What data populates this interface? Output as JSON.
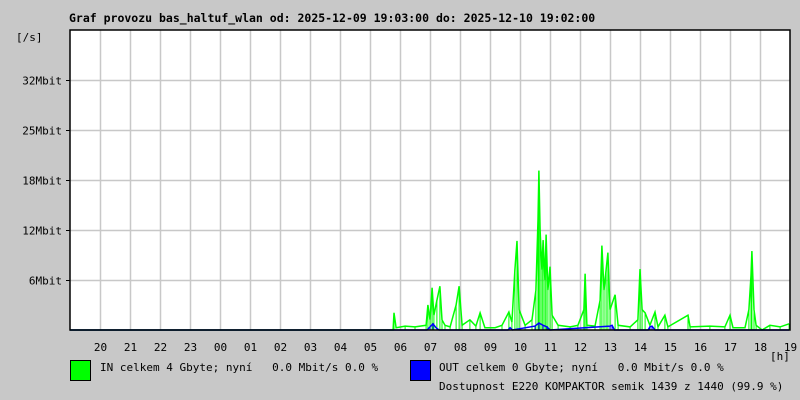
{
  "chart_data": {
    "type": "line",
    "title": "Graf provozu bas_haltuf_wlan od: 2025-12-09 19:03:00 do: 2025-12-10 19:02:00",
    "ylabel": "[/s]",
    "xlabel": "[h]",
    "x_unit": "hours since 2025-12-09 19:00",
    "xlim": [
      0,
      24
    ],
    "ylim": [
      0,
      38.4
    ],
    "y_unit": "Mbit/s",
    "grid": true,
    "yticks": [
      {
        "value": 6.4,
        "label": "6Mbit"
      },
      {
        "value": 12.8,
        "label": "12Mbit"
      },
      {
        "value": 19.2,
        "label": "18Mbit"
      },
      {
        "value": 25.6,
        "label": "25Mbit"
      },
      {
        "value": 32,
        "label": "32Mbit"
      }
    ],
    "xticks": [
      {
        "value": 1,
        "label": "20"
      },
      {
        "value": 2,
        "label": "21"
      },
      {
        "value": 3,
        "label": "22"
      },
      {
        "value": 4,
        "label": "23"
      },
      {
        "value": 5,
        "label": "00"
      },
      {
        "value": 6,
        "label": "01"
      },
      {
        "value": 7,
        "label": "02"
      },
      {
        "value": 8,
        "label": "03"
      },
      {
        "value": 9,
        "label": "04"
      },
      {
        "value": 10,
        "label": "05"
      },
      {
        "value": 11,
        "label": "06"
      },
      {
        "value": 12,
        "label": "07"
      },
      {
        "value": 13,
        "label": "08"
      },
      {
        "value": 14,
        "label": "09"
      },
      {
        "value": 15,
        "label": "10"
      },
      {
        "value": 16,
        "label": "11"
      },
      {
        "value": 17,
        "label": "12"
      },
      {
        "value": 18,
        "label": "13"
      },
      {
        "value": 19,
        "label": "14"
      },
      {
        "value": 20,
        "label": "15"
      },
      {
        "value": 21,
        "label": "16"
      },
      {
        "value": 22,
        "label": "17"
      },
      {
        "value": 23,
        "label": "18"
      },
      {
        "value": 24,
        "label": "19"
      }
    ],
    "series": [
      {
        "name": "IN",
        "color": "#00ff00",
        "points": [
          [
            10.77,
            0
          ],
          [
            10.8,
            2.2
          ],
          [
            10.87,
            0.3
          ],
          [
            11.17,
            0.5
          ],
          [
            11.5,
            0.4
          ],
          [
            11.87,
            0.6
          ],
          [
            11.93,
            3.2
          ],
          [
            12.0,
            1.3
          ],
          [
            12.07,
            5.4
          ],
          [
            12.13,
            1.9
          ],
          [
            12.23,
            3.8
          ],
          [
            12.33,
            5.6
          ],
          [
            12.4,
            1.3
          ],
          [
            12.5,
            0.6
          ],
          [
            12.67,
            0.4
          ],
          [
            12.87,
            3.2
          ],
          [
            12.97,
            5.6
          ],
          [
            13.07,
            0.6
          ],
          [
            13.33,
            1.3
          ],
          [
            13.53,
            0.5
          ],
          [
            13.67,
            2.2
          ],
          [
            13.83,
            0.3
          ],
          [
            14.17,
            0.3
          ],
          [
            14.4,
            0.6
          ],
          [
            14.63,
            2.3
          ],
          [
            14.73,
            1.0
          ],
          [
            14.83,
            7.7
          ],
          [
            14.9,
            11.4
          ],
          [
            14.97,
            2.6
          ],
          [
            15.17,
            0.6
          ],
          [
            15.4,
            1.3
          ],
          [
            15.53,
            5.1
          ],
          [
            15.6,
            14.1
          ],
          [
            15.63,
            20.4
          ],
          [
            15.67,
            12.8
          ],
          [
            15.73,
            7.7
          ],
          [
            15.77,
            11.5
          ],
          [
            15.83,
            6.4
          ],
          [
            15.87,
            12.2
          ],
          [
            15.93,
            5.1
          ],
          [
            16.0,
            8.1
          ],
          [
            16.07,
            1.9
          ],
          [
            16.27,
            0.6
          ],
          [
            16.67,
            0.4
          ],
          [
            16.93,
            0.6
          ],
          [
            17.13,
            2.6
          ],
          [
            17.17,
            7.2
          ],
          [
            17.23,
            0.6
          ],
          [
            17.5,
            0.5
          ],
          [
            17.67,
            3.8
          ],
          [
            17.73,
            10.8
          ],
          [
            17.8,
            5.1
          ],
          [
            17.87,
            7.7
          ],
          [
            17.93,
            9.9
          ],
          [
            18.0,
            2.6
          ],
          [
            18.17,
            4.5
          ],
          [
            18.27,
            0.6
          ],
          [
            18.67,
            0.4
          ],
          [
            18.93,
            1.3
          ],
          [
            19.0,
            7.8
          ],
          [
            19.07,
            2.6
          ],
          [
            19.17,
            2.2
          ],
          [
            19.33,
            0.6
          ],
          [
            19.5,
            2.3
          ],
          [
            19.6,
            0.4
          ],
          [
            19.83,
            1.9
          ],
          [
            19.93,
            0.4
          ],
          [
            20.6,
            1.9
          ],
          [
            20.67,
            0.4
          ],
          [
            21.33,
            0.5
          ],
          [
            21.83,
            0.4
          ],
          [
            22.0,
            1.9
          ],
          [
            22.1,
            0.3
          ],
          [
            22.5,
            0.3
          ],
          [
            22.63,
            2.6
          ],
          [
            22.7,
            7.0
          ],
          [
            22.73,
            10.1
          ],
          [
            22.8,
            2.6
          ],
          [
            22.87,
            0.6
          ],
          [
            23.07,
            0
          ],
          [
            23.33,
            0.6
          ],
          [
            23.67,
            0.4
          ],
          [
            23.97,
            0.8
          ]
        ]
      },
      {
        "name": "OUT",
        "color": "#0000ff",
        "points": [
          [
            10.77,
            0
          ],
          [
            11.9,
            0
          ],
          [
            12.0,
            0.4
          ],
          [
            12.1,
            0.8
          ],
          [
            12.2,
            0.3
          ],
          [
            12.3,
            0
          ],
          [
            14.6,
            0
          ],
          [
            14.67,
            0.3
          ],
          [
            14.75,
            0
          ],
          [
            15.5,
            0.5
          ],
          [
            15.63,
            0.9
          ],
          [
            15.77,
            0.6
          ],
          [
            15.9,
            0.4
          ],
          [
            16.0,
            0
          ],
          [
            18.0,
            0.5
          ],
          [
            18.07,
            0.6
          ],
          [
            18.15,
            0
          ],
          [
            19.27,
            0
          ],
          [
            19.33,
            0.4
          ],
          [
            19.4,
            0.5
          ],
          [
            19.5,
            0
          ],
          [
            23.97,
            0
          ]
        ]
      }
    ]
  },
  "legend": {
    "in_text": "IN celkem 4 Gbyte; nyní   0.0 Mbit/s 0.0 %",
    "out_text": "OUT celkem 0 Gbyte; nyní   0.0 Mbit/s 0.0 %",
    "in_color": "#00ff00",
    "out_color": "#0000ff",
    "availability": "Dostupnost E220 KOMPAKTOR semik 1439 z 1440 (99.9 %)",
    "availability_color": "#ff0000"
  }
}
